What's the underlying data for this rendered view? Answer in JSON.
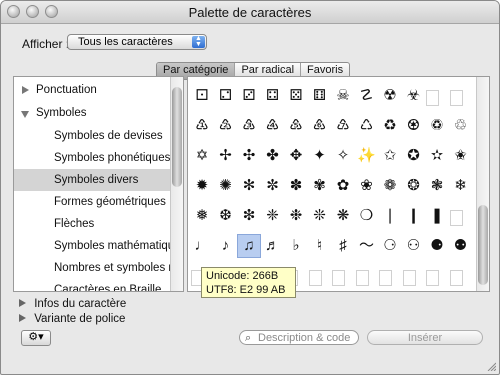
{
  "window": {
    "title": "Palette de caractères"
  },
  "toolbar": {
    "show_label": "Afficher :",
    "show_value": "Tous les caractères"
  },
  "tabs": [
    {
      "label": "Par catégorie",
      "active": true
    },
    {
      "label": "Par radical",
      "active": false
    },
    {
      "label": "Favoris",
      "active": false
    }
  ],
  "categories": [
    {
      "label": "Ponctuation",
      "expandable": true,
      "expanded": false
    },
    {
      "label": "Symboles",
      "expandable": true,
      "expanded": true
    },
    {
      "label": "Symboles de devises",
      "expandable": false
    },
    {
      "label": "Symboles phonétiques",
      "expandable": false
    },
    {
      "label": "Symboles divers",
      "expandable": false,
      "selected": true
    },
    {
      "label": "Formes géométriques",
      "expandable": false
    },
    {
      "label": "Flèches",
      "expandable": false
    },
    {
      "label": "Symboles mathématique",
      "expandable": false
    },
    {
      "label": "Nombres et symboles nu",
      "expandable": false
    },
    {
      "label": "Caractères en Braille",
      "expandable": false
    }
  ],
  "glyph_rows": [
    [
      "⚀",
      "⚁",
      "⚂",
      "⚃",
      "⚄",
      "⚅",
      "☠",
      "☡",
      "☢",
      "☣",
      "",
      ""
    ],
    [
      "♳",
      "♴",
      "♵",
      "♶",
      "♷",
      "♸",
      "♹",
      "♺",
      "♻",
      "♼",
      "♽",
      "♲"
    ],
    [
      "✡",
      "✢",
      "✣",
      "✤",
      "✥",
      "✦",
      "✧",
      "✨",
      "✩",
      "✪",
      "✫",
      "✬"
    ],
    [
      "✹",
      "✺",
      "✻",
      "✼",
      "✽",
      "✾",
      "✿",
      "❀",
      "❁",
      "❂",
      "❃",
      "❄"
    ],
    [
      "❅",
      "❆",
      "❇",
      "❈",
      "❉",
      "❊",
      "❋",
      "❍",
      "❘",
      "❙",
      "❚",
      ""
    ],
    [
      "♩",
      "♪",
      "♫",
      "♬",
      "♭",
      "♮",
      "♯",
      "〜",
      "⚆",
      "⚇",
      "⚈",
      "⚉"
    ],
    [
      "",
      "",
      "",
      "",
      "",
      "",
      "",
      "",
      "",
      "",
      "",
      ""
    ]
  ],
  "selected_glyph": {
    "row": 5,
    "col": 2
  },
  "tooltip": {
    "line1": "Unicode: 266B",
    "line2": "UTF8: E2 99 AB"
  },
  "bottom": {
    "char_info": "Infos du caractère",
    "font_variant": "Variante de police",
    "search_placeholder": "Description & code",
    "insert": "Insérer"
  },
  "icons": {
    "gear": "gear-icon",
    "search": "search-icon"
  }
}
